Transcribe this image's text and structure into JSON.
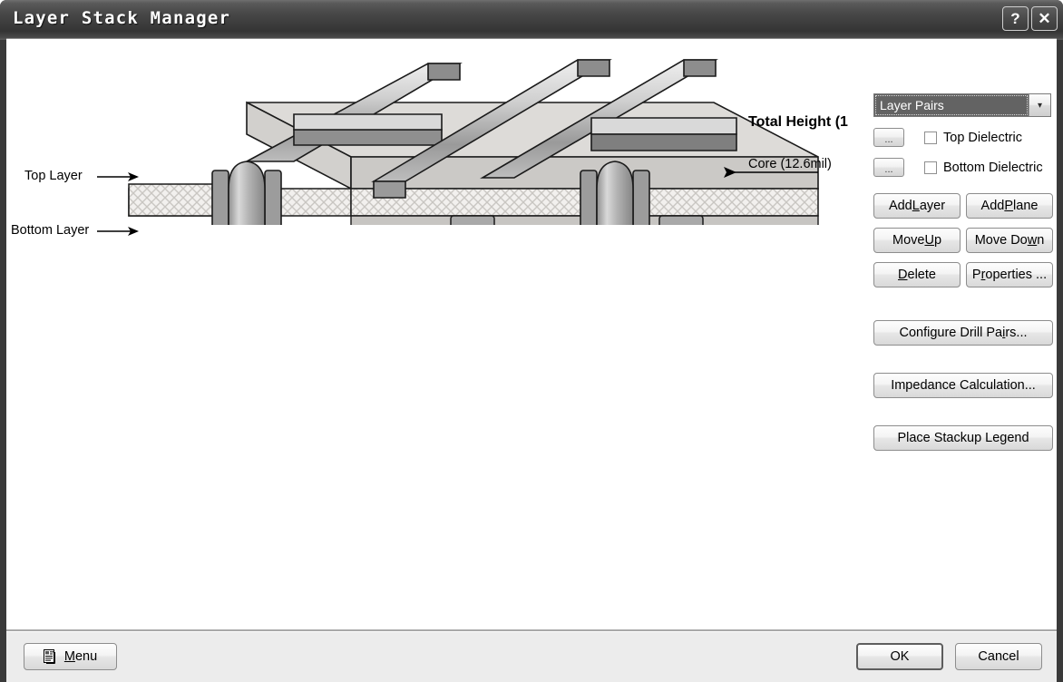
{
  "window": {
    "title": "Layer Stack Manager",
    "help_button": "?",
    "close_button": "✕"
  },
  "illustration": {
    "alt": "pcb-layer-stack-3d-diagram",
    "labels": {
      "top_layer": "Top Layer",
      "bottom_layer": "Bottom Layer",
      "total_height": "Total Height (1",
      "core": "Core (12.6mil)"
    }
  },
  "panel": {
    "stack_mode_combo": {
      "value": "Layer Pairs",
      "arrow": "▾"
    },
    "dielectric": [
      {
        "browse_label": "...",
        "checkbox_label": "Top Dielectric",
        "checked": false
      },
      {
        "browse_label": "...",
        "checkbox_label": "Bottom Dielectric",
        "checked": false
      }
    ],
    "buttons": [
      {
        "pre": "Add ",
        "accel": "L",
        "post": "ayer"
      },
      {
        "pre": "Add ",
        "accel": "P",
        "post": "lane"
      },
      {
        "pre": "Move ",
        "accel": "U",
        "post": "p"
      },
      {
        "pre": "Move Do",
        "accel": "w",
        "post": "n"
      },
      {
        "pre": "",
        "accel": "D",
        "post": "elete"
      },
      {
        "pre": "P",
        "accel": "r",
        "post": "operties ..."
      }
    ],
    "wide_buttons": [
      {
        "pre": "Configure Drill Pa",
        "accel": "i",
        "post": "rs..."
      },
      {
        "pre": "Impedance Calculation...",
        "accel": "",
        "post": ""
      },
      {
        "pre": "Place Stackup Legend",
        "accel": "",
        "post": ""
      }
    ]
  },
  "footer": {
    "menu": {
      "pre": "",
      "accel": "M",
      "post": "enu"
    },
    "ok": "OK",
    "cancel": "Cancel"
  },
  "colors": {
    "titlebar_dark": "#3e3e3e",
    "client_bg": "#ffffff",
    "footer_bg": "#ececec",
    "button_face": "#e6e6e6",
    "combo_selected_bg": "#636363"
  }
}
